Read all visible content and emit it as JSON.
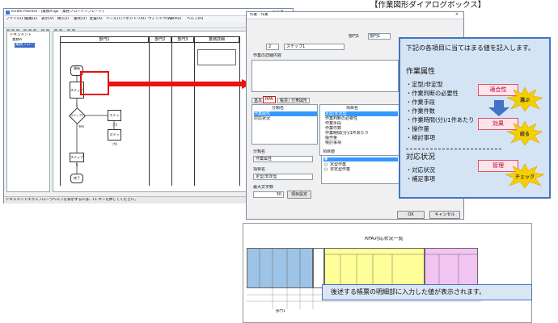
{
  "page_title": "【作業図形ダイアログボックス】",
  "main_window": {
    "title": "iGrafx Process - [業務A.igx - 業務フローテンプレート]",
    "menu": [
      "ファイル(F)",
      "編集(E)",
      "表示(V)",
      "挿入(I)",
      "書式(O)",
      "配置(A)",
      "ツール(T)",
      "リポジトリ(R)",
      "ウィンドウ(W)",
      "RPA(I)",
      "ヘルプ(H)"
    ],
    "tree_items": [
      "ドキュメント",
      "業務A",
      "業務フロー"
    ],
    "lanes": [
      "部門1",
      "部門2",
      "部門3",
      "業務詳細"
    ],
    "nodes": {
      "start": "開始",
      "step1": "ステップ1",
      "decision": "ステップ2",
      "step3": "ステップ3",
      "step4": "ステップ4",
      "step5": "ステップ5",
      "end": "終了",
      "yes": "Yes"
    },
    "status_left": "ドキュメントエクスプローラ",
    "status_text": "ヘルプを表示するには、F1 キーを押してください。"
  },
  "dialog": {
    "title": "作業 - 作業",
    "header_dept": "部門1",
    "header_value": "部門1",
    "step_number": "2",
    "step_name": "ステップ1",
    "detail_label": "作業の詳細内容",
    "tabs": [
      "基本",
      "RPA",
      "帳票",
      "付帯図形"
    ],
    "list_header_left": "分類名",
    "list_header_right": "項目名",
    "left_items": [
      "作業属性",
      "対応状況"
    ],
    "right_items": [
      "定型/非定型",
      "作業判断の必要性",
      "作業手段",
      "作業件数",
      "作業時間(分)/1件あたり",
      "操作量",
      "検討事項"
    ],
    "category_label": "分類名",
    "category_value": "作業属性",
    "item_label": "項目名",
    "item_value": "定型/非定型",
    "max_chars_label": "最大文字数",
    "max_chars_value": "30",
    "settings_button": "項目設定",
    "options_label": "項目値",
    "options": [
      "",
      "定型作業",
      "非定型作業"
    ],
    "ok": "OK",
    "cancel": "キャンセル"
  },
  "callout": {
    "heading": "下記の各項目に当てはまる値を記入します。",
    "section1": "作業属性",
    "items1": [
      "・定型/非定型",
      "・作業判断の必要性",
      "・作業手段",
      "・作業件数",
      "・作業時間(分)/1件あたり",
      "・操作量",
      "・検討事項"
    ],
    "section2": "対応状況",
    "items2": [
      "・対応状況",
      "・補足事項"
    ],
    "labels": [
      "適合性",
      "効果",
      "管理"
    ],
    "bursts": [
      "選ぶ",
      "絞る",
      "チェック"
    ]
  },
  "sheet": {
    "title": "RPA対応状況一覧",
    "note": "後述する帳票の明細部に入力した値が表示されます。",
    "row_label": "部門1"
  },
  "colors": {
    "accent_blue": "#4472c4",
    "callout_bg": "#d5e4f5",
    "red": "#e01010",
    "col_blue": "#9dc3e6",
    "col_yellow": "#ffff99",
    "col_purple": "#f2c4f2"
  }
}
